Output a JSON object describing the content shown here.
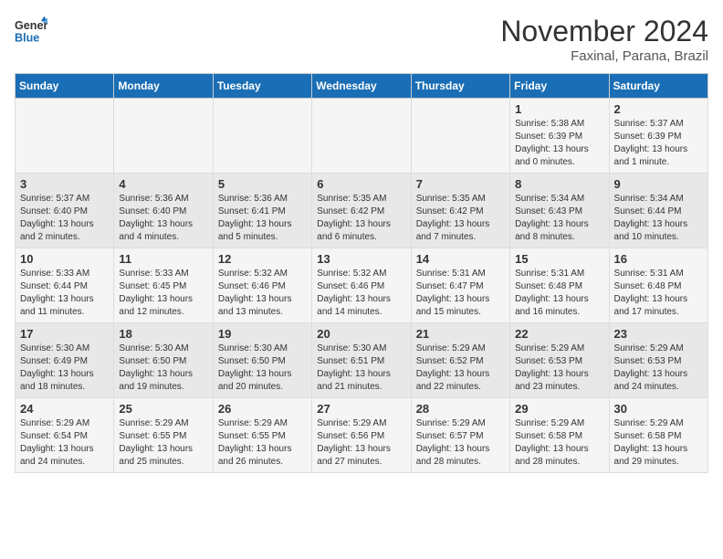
{
  "header": {
    "logo_line1": "General",
    "logo_line2": "Blue",
    "month_title": "November 2024",
    "location": "Faxinal, Parana, Brazil"
  },
  "weekdays": [
    "Sunday",
    "Monday",
    "Tuesday",
    "Wednesday",
    "Thursday",
    "Friday",
    "Saturday"
  ],
  "weeks": [
    [
      {
        "day": "",
        "info": ""
      },
      {
        "day": "",
        "info": ""
      },
      {
        "day": "",
        "info": ""
      },
      {
        "day": "",
        "info": ""
      },
      {
        "day": "",
        "info": ""
      },
      {
        "day": "1",
        "info": "Sunrise: 5:38 AM\nSunset: 6:39 PM\nDaylight: 13 hours and 0 minutes."
      },
      {
        "day": "2",
        "info": "Sunrise: 5:37 AM\nSunset: 6:39 PM\nDaylight: 13 hours and 1 minute."
      }
    ],
    [
      {
        "day": "3",
        "info": "Sunrise: 5:37 AM\nSunset: 6:40 PM\nDaylight: 13 hours and 2 minutes."
      },
      {
        "day": "4",
        "info": "Sunrise: 5:36 AM\nSunset: 6:40 PM\nDaylight: 13 hours and 4 minutes."
      },
      {
        "day": "5",
        "info": "Sunrise: 5:36 AM\nSunset: 6:41 PM\nDaylight: 13 hours and 5 minutes."
      },
      {
        "day": "6",
        "info": "Sunrise: 5:35 AM\nSunset: 6:42 PM\nDaylight: 13 hours and 6 minutes."
      },
      {
        "day": "7",
        "info": "Sunrise: 5:35 AM\nSunset: 6:42 PM\nDaylight: 13 hours and 7 minutes."
      },
      {
        "day": "8",
        "info": "Sunrise: 5:34 AM\nSunset: 6:43 PM\nDaylight: 13 hours and 8 minutes."
      },
      {
        "day": "9",
        "info": "Sunrise: 5:34 AM\nSunset: 6:44 PM\nDaylight: 13 hours and 10 minutes."
      }
    ],
    [
      {
        "day": "10",
        "info": "Sunrise: 5:33 AM\nSunset: 6:44 PM\nDaylight: 13 hours and 11 minutes."
      },
      {
        "day": "11",
        "info": "Sunrise: 5:33 AM\nSunset: 6:45 PM\nDaylight: 13 hours and 12 minutes."
      },
      {
        "day": "12",
        "info": "Sunrise: 5:32 AM\nSunset: 6:46 PM\nDaylight: 13 hours and 13 minutes."
      },
      {
        "day": "13",
        "info": "Sunrise: 5:32 AM\nSunset: 6:46 PM\nDaylight: 13 hours and 14 minutes."
      },
      {
        "day": "14",
        "info": "Sunrise: 5:31 AM\nSunset: 6:47 PM\nDaylight: 13 hours and 15 minutes."
      },
      {
        "day": "15",
        "info": "Sunrise: 5:31 AM\nSunset: 6:48 PM\nDaylight: 13 hours and 16 minutes."
      },
      {
        "day": "16",
        "info": "Sunrise: 5:31 AM\nSunset: 6:48 PM\nDaylight: 13 hours and 17 minutes."
      }
    ],
    [
      {
        "day": "17",
        "info": "Sunrise: 5:30 AM\nSunset: 6:49 PM\nDaylight: 13 hours and 18 minutes."
      },
      {
        "day": "18",
        "info": "Sunrise: 5:30 AM\nSunset: 6:50 PM\nDaylight: 13 hours and 19 minutes."
      },
      {
        "day": "19",
        "info": "Sunrise: 5:30 AM\nSunset: 6:50 PM\nDaylight: 13 hours and 20 minutes."
      },
      {
        "day": "20",
        "info": "Sunrise: 5:30 AM\nSunset: 6:51 PM\nDaylight: 13 hours and 21 minutes."
      },
      {
        "day": "21",
        "info": "Sunrise: 5:29 AM\nSunset: 6:52 PM\nDaylight: 13 hours and 22 minutes."
      },
      {
        "day": "22",
        "info": "Sunrise: 5:29 AM\nSunset: 6:53 PM\nDaylight: 13 hours and 23 minutes."
      },
      {
        "day": "23",
        "info": "Sunrise: 5:29 AM\nSunset: 6:53 PM\nDaylight: 13 hours and 24 minutes."
      }
    ],
    [
      {
        "day": "24",
        "info": "Sunrise: 5:29 AM\nSunset: 6:54 PM\nDaylight: 13 hours and 24 minutes."
      },
      {
        "day": "25",
        "info": "Sunrise: 5:29 AM\nSunset: 6:55 PM\nDaylight: 13 hours and 25 minutes."
      },
      {
        "day": "26",
        "info": "Sunrise: 5:29 AM\nSunset: 6:55 PM\nDaylight: 13 hours and 26 minutes."
      },
      {
        "day": "27",
        "info": "Sunrise: 5:29 AM\nSunset: 6:56 PM\nDaylight: 13 hours and 27 minutes."
      },
      {
        "day": "28",
        "info": "Sunrise: 5:29 AM\nSunset: 6:57 PM\nDaylight: 13 hours and 28 minutes."
      },
      {
        "day": "29",
        "info": "Sunrise: 5:29 AM\nSunset: 6:58 PM\nDaylight: 13 hours and 28 minutes."
      },
      {
        "day": "30",
        "info": "Sunrise: 5:29 AM\nSunset: 6:58 PM\nDaylight: 13 hours and 29 minutes."
      }
    ]
  ]
}
